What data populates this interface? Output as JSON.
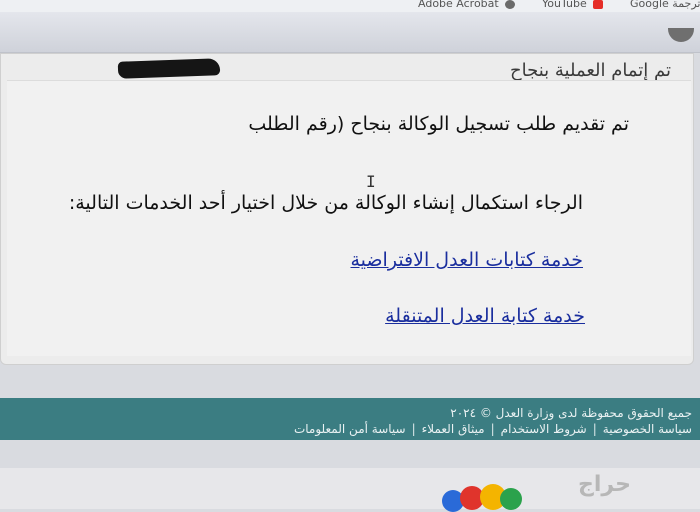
{
  "bookmarks": [
    {
      "label": "Adobe Acrobat",
      "color": "#8a8a8a"
    },
    {
      "label": "YouTube",
      "color": "#e52d27"
    },
    {
      "label": "Google ترجمة",
      "color": "#4285f4"
    }
  ],
  "panel": {
    "title": "تم إتمام العملية بنجاح",
    "message": "تم تقديم طلب تسجيل الوكالة بنجاح (رقم الطلب",
    "instruction": "الرجاء استكمال إنشاء الوكالة من خلال اختيار أحد الخدمات التالية:",
    "links": [
      "خدمة كتابات العدل الافتراضية",
      "خدمة كتابة العدل المتنقلة"
    ]
  },
  "footer": {
    "copyright": "جميع الحقوق محفوظة لدى وزارة العدل © ٢٠٢٤",
    "links": [
      "سياسة الخصوصية",
      "شروط الاستخدام",
      "ميثاق العملاء",
      "سياسة أمن المعلومات"
    ]
  },
  "watermark": "حراج",
  "colors": {
    "footer_bg": "#3b7d82",
    "link": "#1a2e9e"
  }
}
